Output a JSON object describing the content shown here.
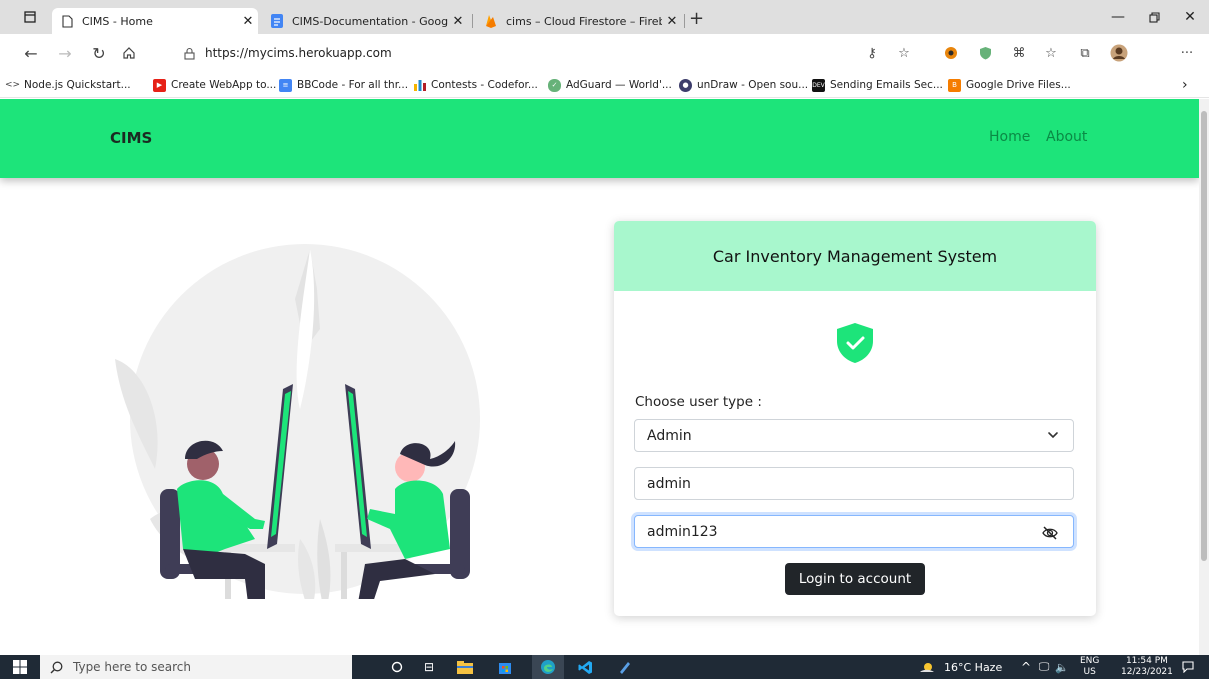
{
  "browser": {
    "tabs": [
      {
        "title": "CIMS - Home",
        "active": true
      },
      {
        "title": "CIMS-Documentation - Google D",
        "active": false
      },
      {
        "title": "cims – Cloud Firestore – Firebase",
        "active": false
      }
    ],
    "url": "https://mycims.herokuapp.com",
    "bookmarks": [
      {
        "label": "Node.js Quickstart...",
        "icon": "node-icon",
        "color": "#444444"
      },
      {
        "label": "Create WebApp to...",
        "icon": "youtube-icon",
        "color": "#e62117"
      },
      {
        "label": "BBCode - For all thr...",
        "icon": "docs-icon",
        "color": "#4285f4"
      },
      {
        "label": "Contests - Codefor...",
        "icon": "codeforces-icon",
        "color": "#f5b400"
      },
      {
        "label": "AdGuard — World'...",
        "icon": "adguard-icon",
        "color": "#67b279"
      },
      {
        "label": "unDraw - Open sou...",
        "icon": "undraw-icon",
        "color": "#3d3d6b"
      },
      {
        "label": "Sending Emails Sec...",
        "icon": "dev-icon",
        "color": "#111111"
      },
      {
        "label": "Google Drive Files...",
        "icon": "blogger-icon",
        "color": "#f57d00"
      }
    ]
  },
  "navbar": {
    "brand": "CIMS",
    "links": [
      "Home",
      "About"
    ]
  },
  "login": {
    "header": "Car Inventory Management System",
    "user_type_label": "Choose user type :",
    "user_type_value": "Admin",
    "username_value": "admin",
    "password_value": "admin123",
    "button_label": "Login to account"
  },
  "taskbar": {
    "search_placeholder": "Type here to search",
    "weather": "16°C  Haze",
    "language": "ENG",
    "region": "US",
    "time": "11:54 PM",
    "date": "12/23/2021"
  },
  "colors": {
    "accent": "#1de47a",
    "header_bg": "#a8f7cd",
    "button_bg": "#212529"
  }
}
